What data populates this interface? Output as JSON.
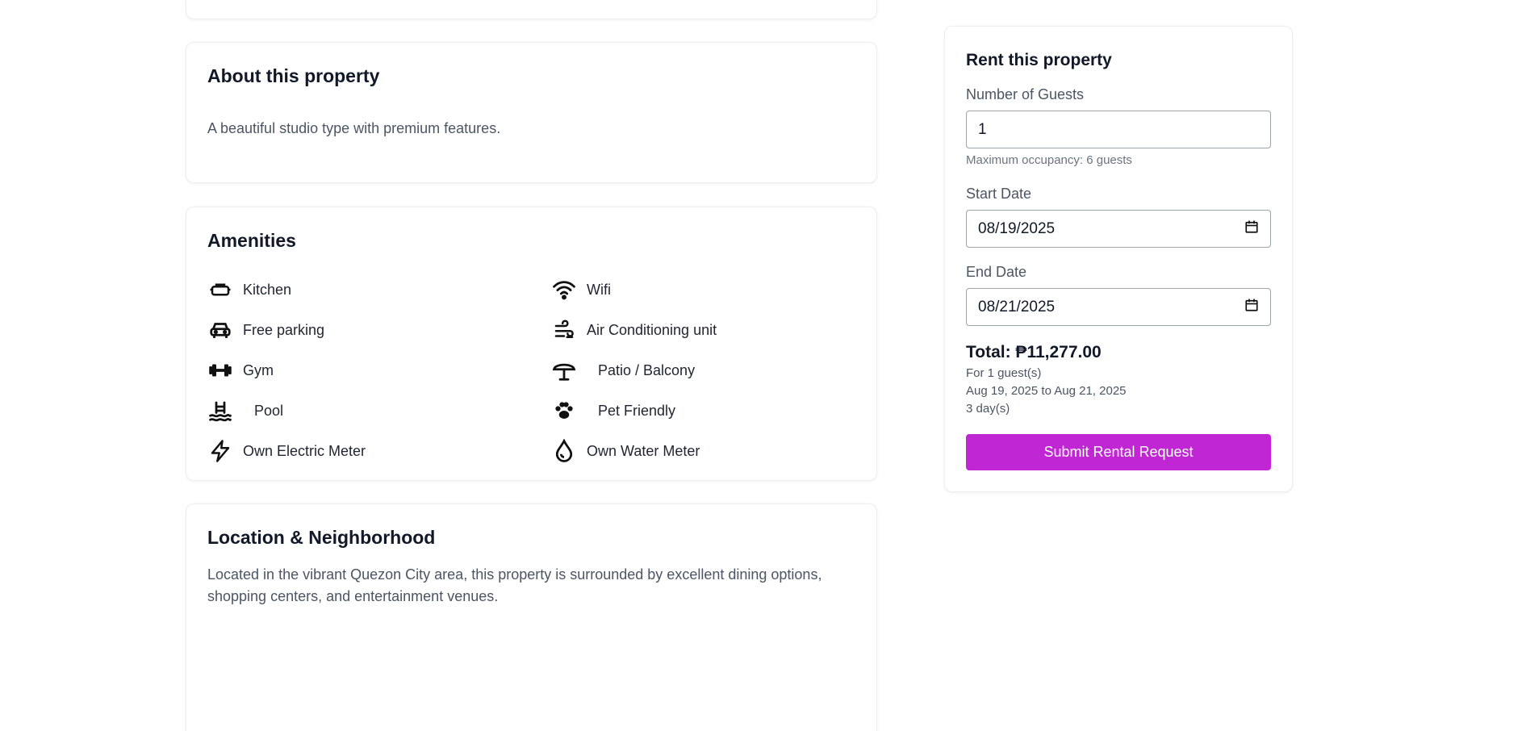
{
  "about": {
    "title": "About this property",
    "description": "A beautiful studio type with premium features."
  },
  "amenities": {
    "title": "Amenities",
    "items": [
      {
        "label": "Kitchen",
        "icon": "kitchen-icon"
      },
      {
        "label": "Wifi",
        "icon": "wifi-icon"
      },
      {
        "label": "Free parking",
        "icon": "car-icon"
      },
      {
        "label": "Air Conditioning unit",
        "icon": "air-conditioning-icon"
      },
      {
        "label": "Gym",
        "icon": "dumbbell-icon"
      },
      {
        "label": "Patio / Balcony",
        "icon": "umbrella-icon"
      },
      {
        "label": "Pool",
        "icon": "pool-icon"
      },
      {
        "label": "Pet Friendly",
        "icon": "paw-icon"
      },
      {
        "label": "Own Electric Meter",
        "icon": "lightning-icon"
      },
      {
        "label": "Own Water Meter",
        "icon": "water-drop-icon"
      }
    ]
  },
  "location": {
    "title": "Location & Neighborhood",
    "description": "Located in the vibrant Quezon City area, this property is surrounded by excellent dining options, shopping centers, and entertainment venues."
  },
  "rent": {
    "title": "Rent this property",
    "guests_label": "Number of Guests",
    "guests_value": "1",
    "max_occupancy": "Maximum occupancy: 6 guests",
    "start_label": "Start Date",
    "start_value": "08/19/2025",
    "end_label": "End Date",
    "end_value": "08/21/2025",
    "total": "Total: ₱11,277.00",
    "guests_summary": "For 1 guest(s)",
    "date_range": "Aug 19, 2025 to Aug 21, 2025",
    "days": "3 day(s)",
    "submit_label": "Submit Rental Request",
    "accent_color": "#c026d3"
  }
}
